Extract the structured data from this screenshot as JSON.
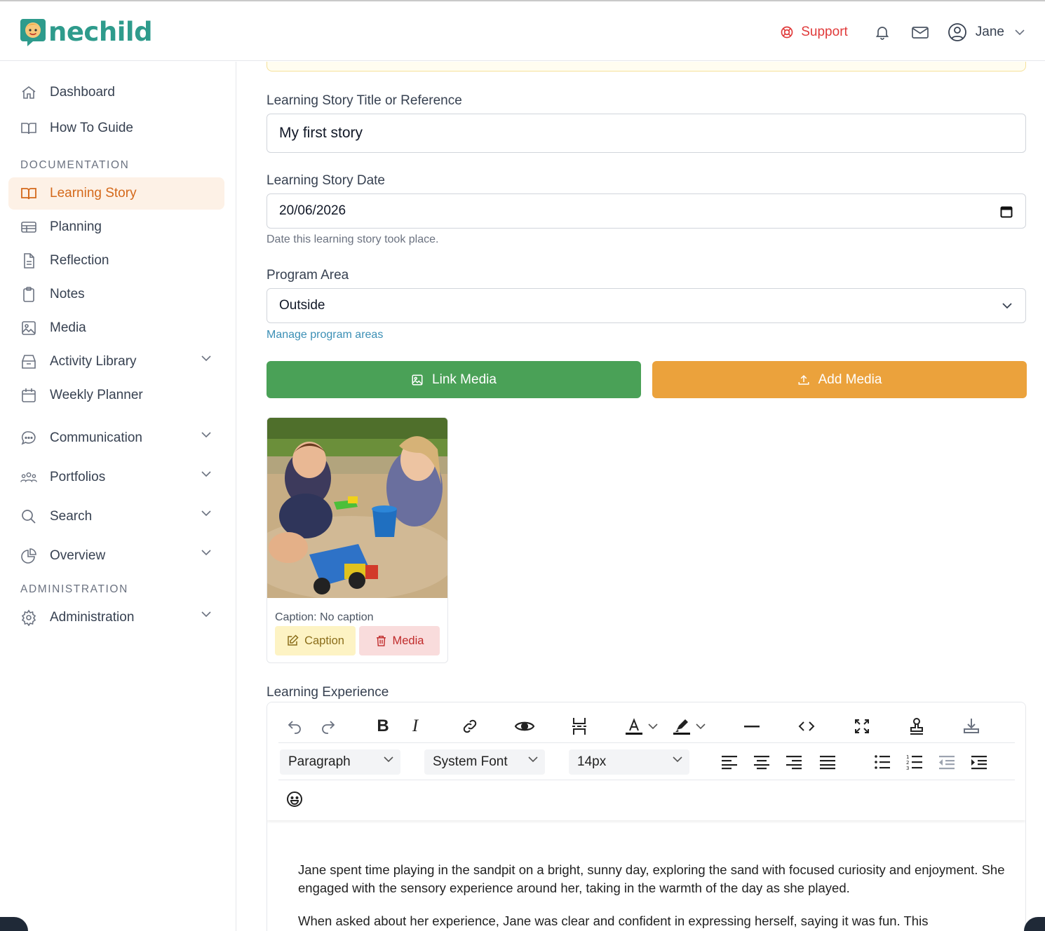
{
  "app": {
    "logo_main": "nechild",
    "logo_first": "O"
  },
  "topbar": {
    "support": "Support",
    "user_name": "Jane"
  },
  "sidebar": {
    "items_top": [
      {
        "label": "Dashboard",
        "icon": "home-icon"
      },
      {
        "label": "How To Guide",
        "icon": "book-open-icon"
      }
    ],
    "section_documentation": "DOCUMENTATION",
    "items_doc": [
      {
        "label": "Learning Story",
        "icon": "book-open-icon",
        "active": true
      },
      {
        "label": "Planning",
        "icon": "table-icon"
      },
      {
        "label": "Reflection",
        "icon": "document-icon"
      },
      {
        "label": "Notes",
        "icon": "clipboard-icon"
      },
      {
        "label": "Media",
        "icon": "image-icon"
      },
      {
        "label": "Activity Library",
        "icon": "archive-icon",
        "expandable": true
      },
      {
        "label": "Weekly Planner",
        "icon": "calendar-icon"
      },
      {
        "label": "Communication",
        "icon": "chat-icon",
        "expandable": true
      },
      {
        "label": "Portfolios",
        "icon": "users-icon",
        "expandable": true
      },
      {
        "label": "Search",
        "icon": "search-icon",
        "expandable": true
      },
      {
        "label": "Overview",
        "icon": "pie-chart-icon",
        "expandable": true
      }
    ],
    "section_administration": "ADMINISTRATION",
    "items_admin": [
      {
        "label": "Administration",
        "icon": "gear-icon",
        "expandable": true
      }
    ]
  },
  "form": {
    "title_label": "Learning Story Title or Reference",
    "title_value": "My first story",
    "date_label": "Learning Story Date",
    "date_value": "20/06/2026",
    "date_help": "Date this learning story took place.",
    "program_label": "Program Area",
    "program_value": "Outside",
    "manage_link": "Manage program areas",
    "link_media_btn": "Link Media",
    "add_media_btn": "Add Media",
    "link_color": "#4aa157",
    "add_color": "#eba23c"
  },
  "media_card": {
    "caption": "Caption: No caption",
    "caption_btn": "Caption",
    "media_btn": "Media"
  },
  "editor": {
    "label": "Learning Experience",
    "block_format": "Paragraph",
    "font_family": "System Font",
    "font_size": "14px",
    "paragraphs": [
      "Jane spent time playing in the sandpit on a bright, sunny day, exploring the sand with focused curiosity and enjoyment. She engaged with the sensory experience around her, taking in the warmth of the day as she played.",
      "When asked about her experience, Jane was clear and confident in expressing herself, saying it was fun. This"
    ]
  }
}
